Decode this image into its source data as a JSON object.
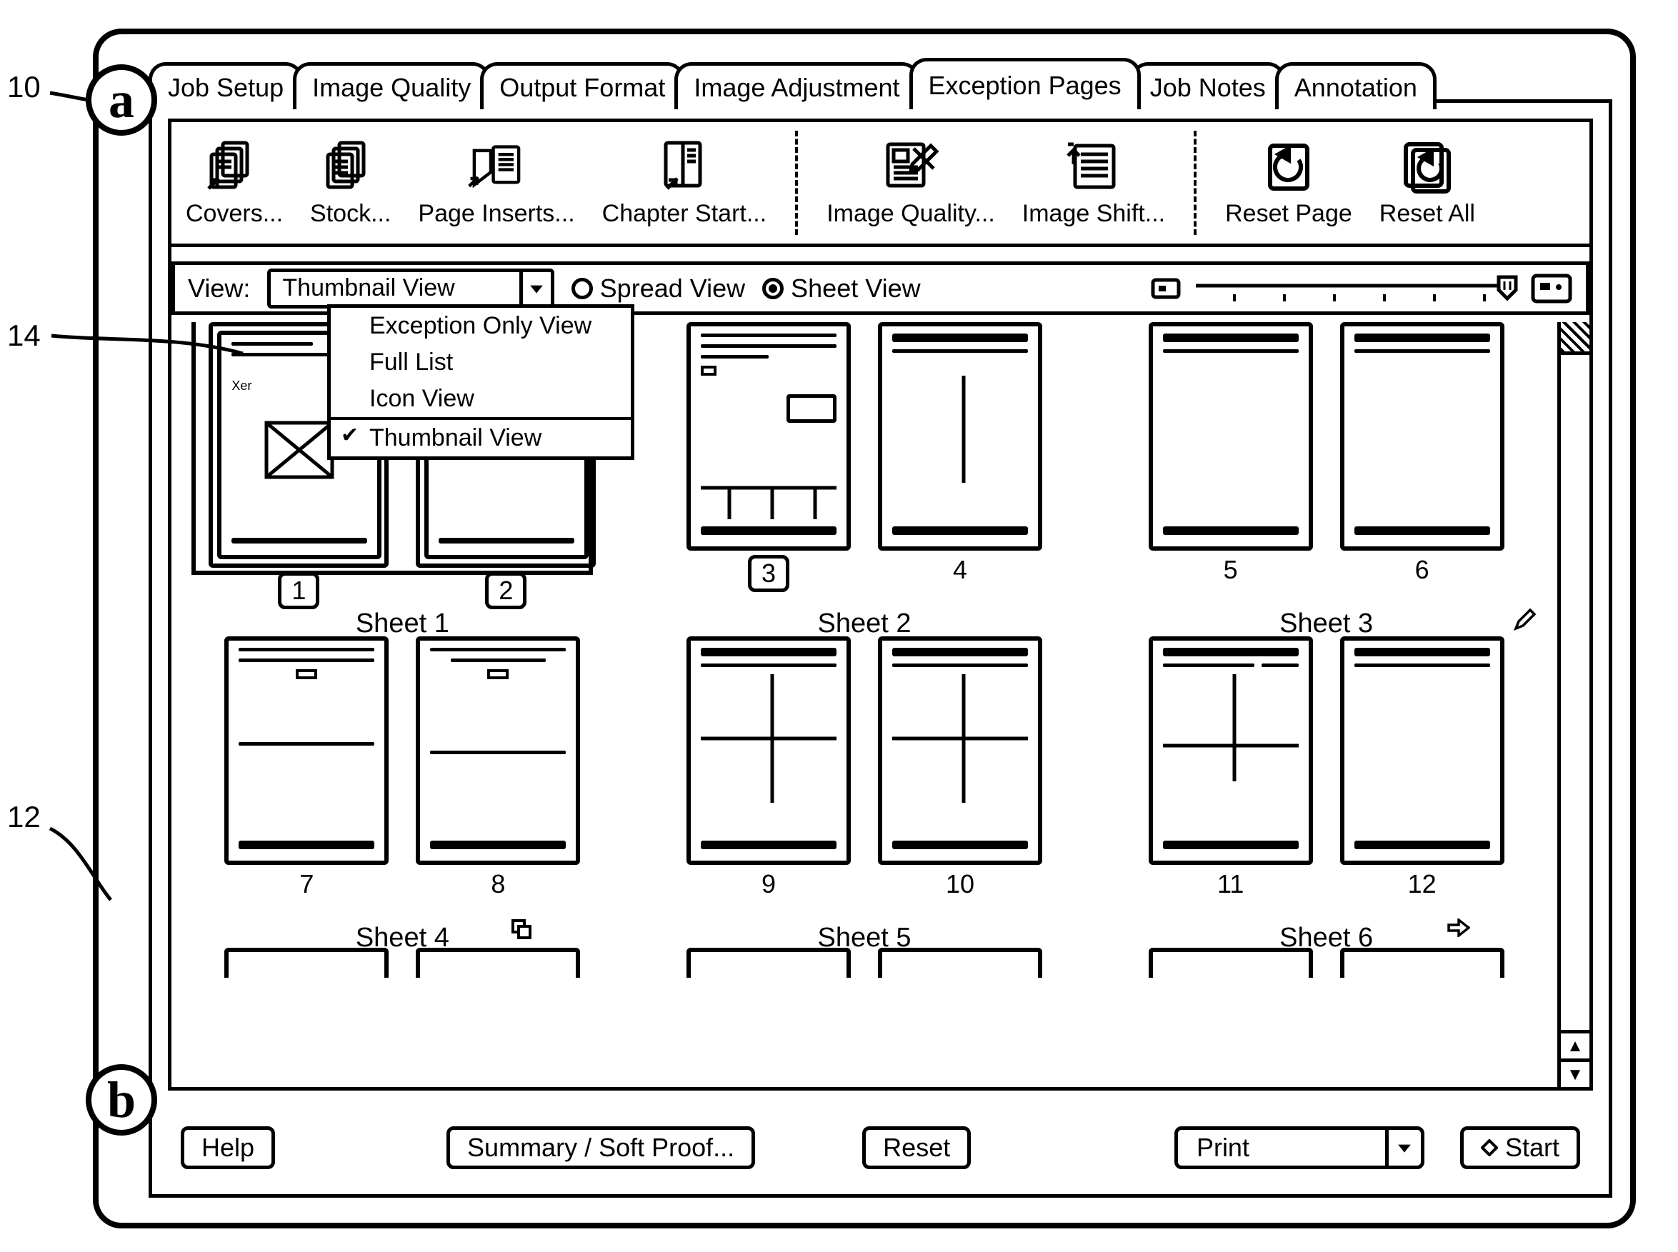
{
  "refs": {
    "r10": "10",
    "r12": "12",
    "r14": "14"
  },
  "badges": {
    "a": "a",
    "b": "b"
  },
  "tabs": [
    "Job Setup",
    "Image Quality",
    "Output Format",
    "Image Adjustment",
    "Exception Pages",
    "Job Notes",
    "Annotation"
  ],
  "active_tab_index": 4,
  "toolbar": [
    {
      "label": "Covers..."
    },
    {
      "label": "Stock..."
    },
    {
      "label": "Page Inserts..."
    },
    {
      "label": "Chapter Start..."
    },
    {
      "sep": true
    },
    {
      "label": "Image Quality..."
    },
    {
      "label": "Image Shift..."
    },
    {
      "sep": true
    },
    {
      "label": "Reset Page"
    },
    {
      "label": "Reset All"
    }
  ],
  "view": {
    "label": "View:",
    "selected": "Thumbnail View",
    "options": [
      "Exception Only View",
      "Full List",
      "Icon View",
      "Thumbnail View"
    ],
    "checked_index": 3,
    "spread": "Spread View",
    "sheet": "Sheet View",
    "radio_selected": "sheet"
  },
  "thumbs": {
    "row1": {
      "sheets": [
        {
          "label": "Sheet 1",
          "pages": [
            {
              "n": "1",
              "boxed": true
            },
            {
              "n": "2",
              "boxed": true
            }
          ],
          "boundary": true
        },
        {
          "label": "Sheet 2",
          "pages": [
            {
              "n": "3",
              "boxed": true
            },
            {
              "n": "4"
            }
          ]
        },
        {
          "label": "Sheet 3",
          "pages": [
            {
              "n": "5"
            },
            {
              "n": "6"
            }
          ],
          "edit": true
        }
      ]
    },
    "row2": {
      "sheets": [
        {
          "label": "Sheet 4",
          "pages": [
            {
              "n": "7"
            },
            {
              "n": "8"
            }
          ],
          "copy": true
        },
        {
          "label": "Sheet 5",
          "pages": [
            {
              "n": "9"
            },
            {
              "n": "10"
            }
          ]
        },
        {
          "label": "Sheet 6",
          "pages": [
            {
              "n": "11"
            },
            {
              "n": "12"
            }
          ],
          "arrow": true
        }
      ]
    }
  },
  "cover_text": "Xer",
  "bottom": {
    "help": "Help",
    "summary": "Summary / Soft Proof...",
    "reset": "Reset",
    "print": "Print",
    "start": "Start"
  }
}
